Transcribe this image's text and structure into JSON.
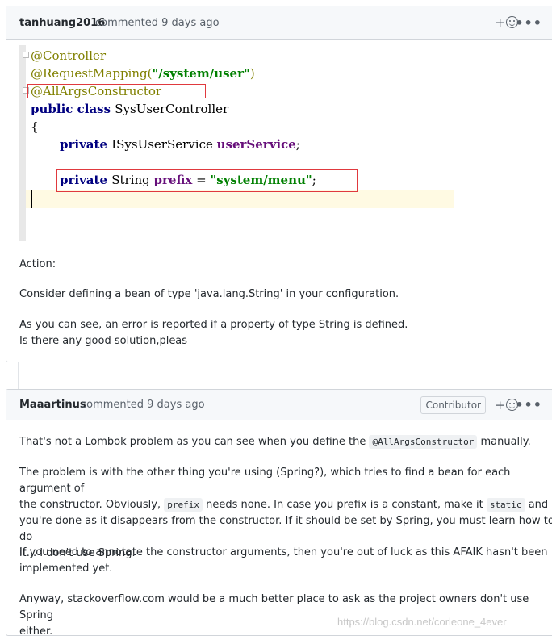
{
  "comment1": {
    "author": "tanhuang2016",
    "meta": "commented 9 days ago",
    "code": {
      "l1": "@Controller",
      "l2a": "@RequestMapping(",
      "l2b": "\"/system/user\"",
      "l2c": ")",
      "l3": "@AllArgsConstructor",
      "l4a": "public class ",
      "l4b": "SysUserController",
      "l5": "{",
      "l6a": "private ",
      "l6b": "ISysUserService ",
      "l6c": "userService",
      "l6d": ";",
      "l7a": "private ",
      "l7b": "String ",
      "l7c": "prefix",
      "l7d": " = ",
      "l7e": "\"system/menu\"",
      "l7f": ";"
    },
    "p1": "Action:",
    "p2": "Consider defining a bean of type 'java.lang.String' in your configuration.",
    "p3a": "As you can see, an error is reported if a property of type String is defined.",
    "p3b": "Is there any good solution,pleas"
  },
  "comment2": {
    "author": "Maaartinus",
    "meta": "commented 9 days ago",
    "badge": "Contributor",
    "p1a": "That's not a Lombok problem as you can see when you define the ",
    "p1code": "@AllArgsConstructor",
    "p1b": " manually.",
    "p2a": "The problem is with the other thing you're using (Spring?), which tries to find a bean for each argument of",
    "p2b": "the constructor. Obviously, ",
    "p2code1": "prefix",
    "p2c": " needs none. In case you prefix is a constant, make it ",
    "p2code2": "static",
    "p2d": " and",
    "p2e": "you're done as it disappears from the constructor. If it should be set by Spring, you must learn how to do",
    "p2f": "it... I don't use Spring.",
    "p3a": "If you need to annotate the constructor arguments, then you're out of luck as this AFAIK hasn't been",
    "p3b": "implemented yet.",
    "p4a": "Anyway, stackoverflow.com would be a much better place to ask as the project owners don't use Spring",
    "p4b": "either."
  },
  "reaction": {
    "plus": "+"
  },
  "kebab": "•••",
  "watermark": "https://blog.csdn.net/corleone_4ever"
}
